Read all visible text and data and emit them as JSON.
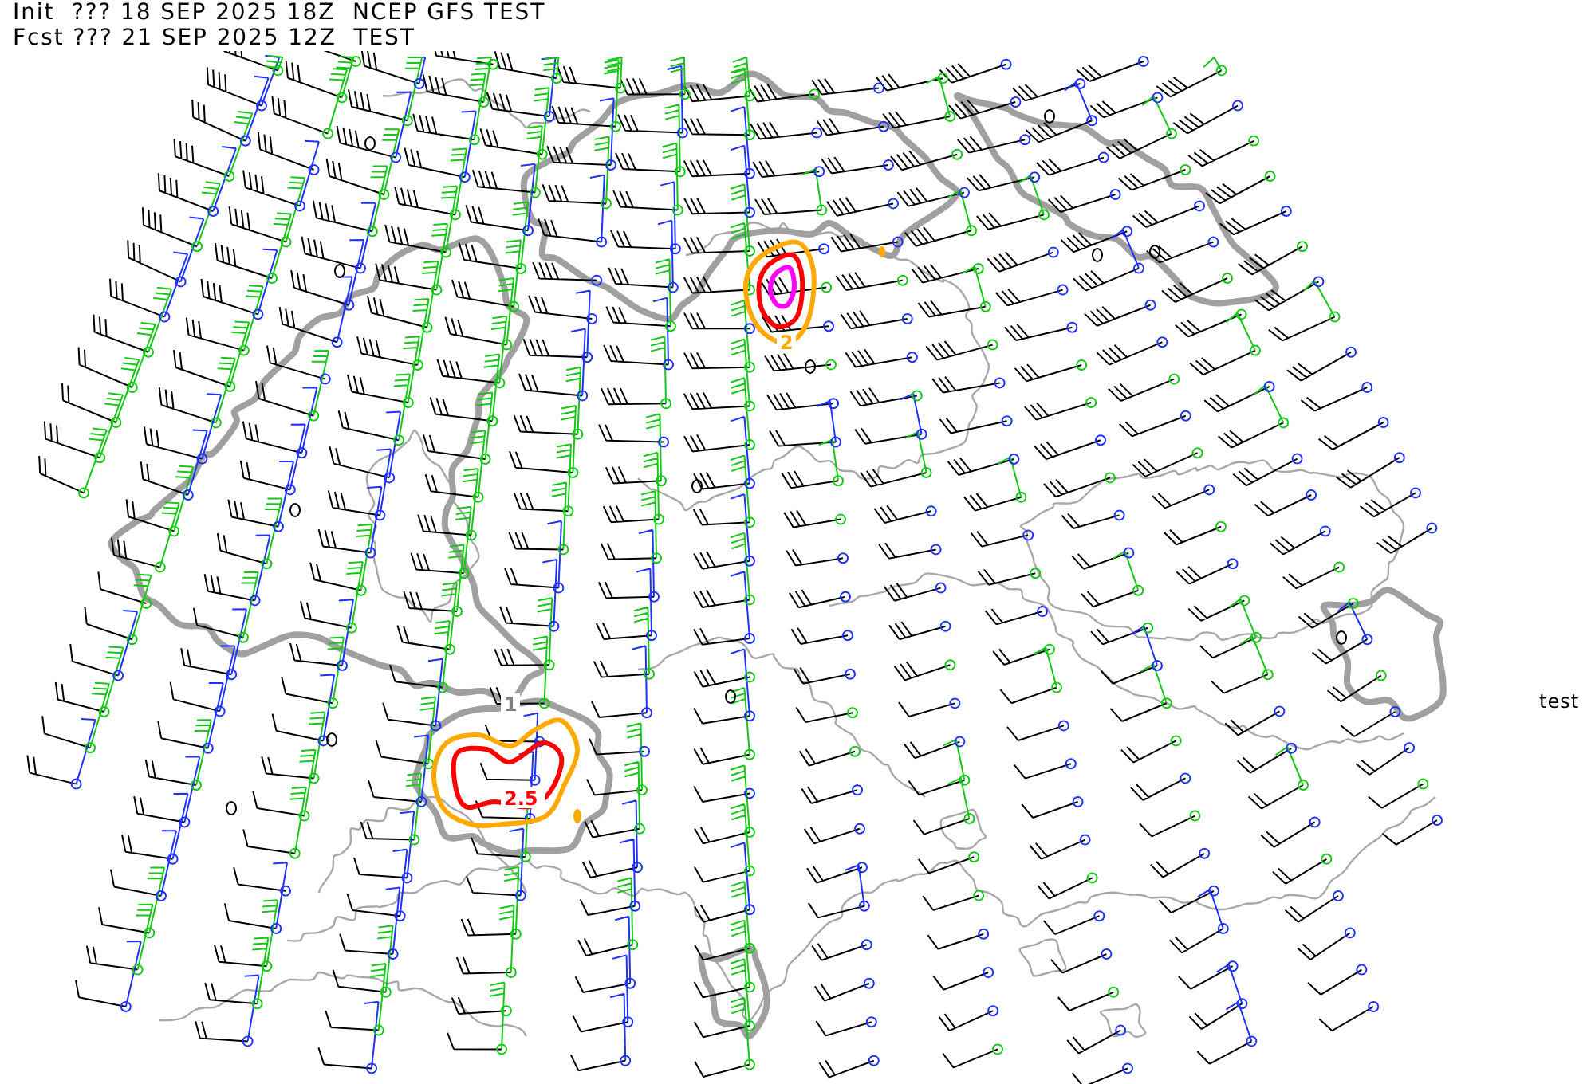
{
  "header": {
    "lines": [
      "Init  ??? 18 SEP 2025 18Z  NCEP GFS TEST",
      "Fcst ??? 21 SEP 2025 12Z  TEST"
    ]
  },
  "map": {
    "contour_labels": [
      {
        "text": "2.5",
        "color": "#ff0000"
      },
      {
        "text": "1",
        "color": "#808080"
      },
      {
        "text": "2",
        "color": "#ffaa00"
      }
    ]
  },
  "side_label": "test"
}
